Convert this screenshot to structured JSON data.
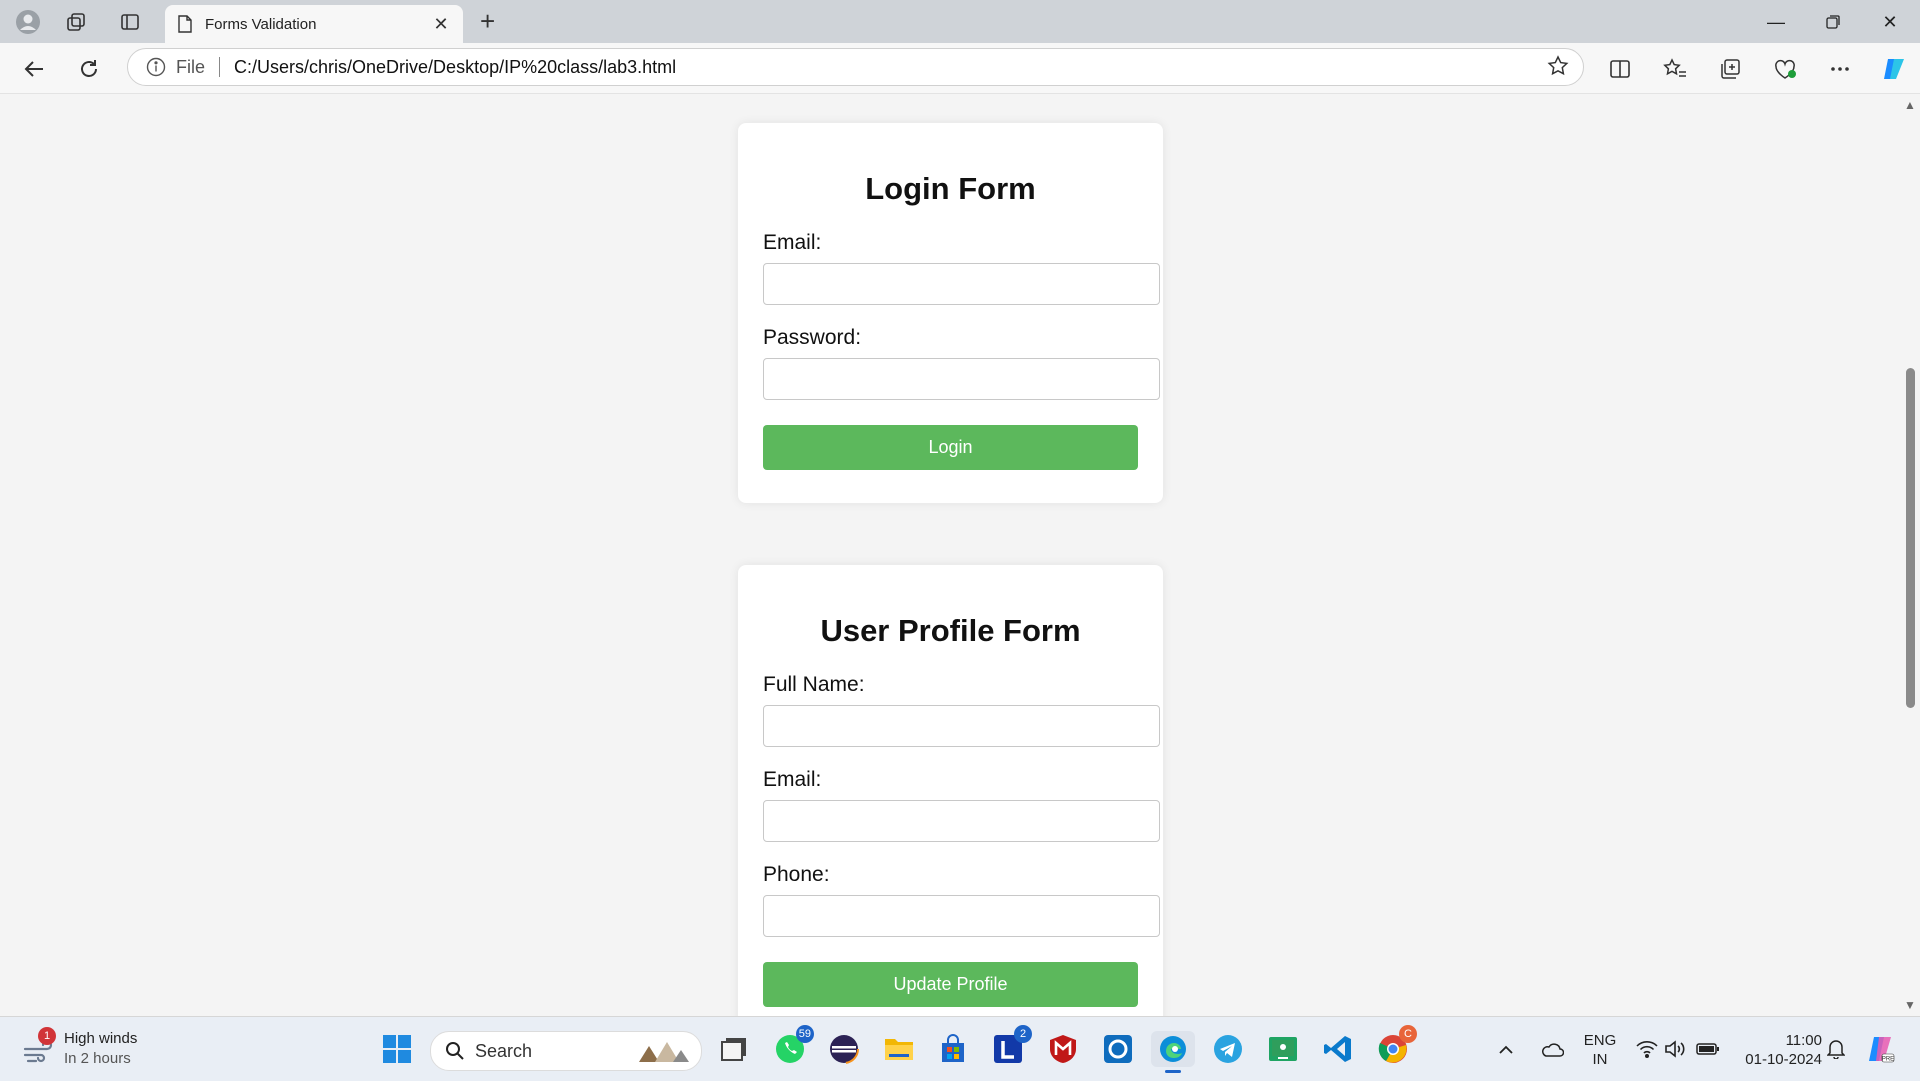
{
  "browser": {
    "tab_title": "Forms Validation",
    "address_prefix": "File",
    "url": "C:/Users/chris/OneDrive/Desktop/IP%20class/lab3.html"
  },
  "login_form": {
    "title": "Login Form",
    "email_label": "Email:",
    "password_label": "Password:",
    "submit_label": "Login"
  },
  "profile_form": {
    "title": "User Profile Form",
    "fullname_label": "Full Name:",
    "email_label": "Email:",
    "phone_label": "Phone:",
    "submit_label": "Update Profile"
  },
  "taskbar": {
    "weather_title": "High winds",
    "weather_sub": "In 2 hours",
    "weather_badge": "1",
    "search_label": "Search",
    "whatsapp_badge": "59",
    "l_badge": "2",
    "lang_top": "ENG",
    "lang_bottom": "IN",
    "time": "11:00",
    "date": "01-10-2024"
  },
  "colors": {
    "button_green": "#5cb85c",
    "page_bg": "#f4f4f4"
  }
}
